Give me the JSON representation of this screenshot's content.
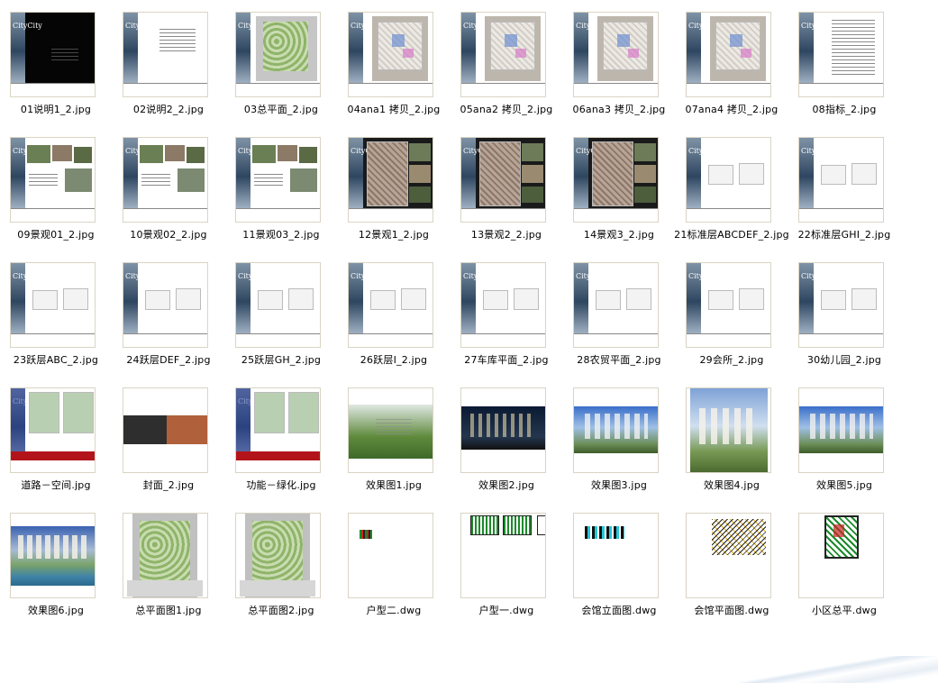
{
  "files": [
    {
      "name": "01说明1_2.jpg",
      "kind": "dark-sheet"
    },
    {
      "name": "02说明2_2.jpg",
      "kind": "text-sheet"
    },
    {
      "name": "03总平面_2.jpg",
      "kind": "site-plan-sheet"
    },
    {
      "name": "04ana1 拷贝_2.jpg",
      "kind": "analysis-sheet"
    },
    {
      "name": "05ana2 拷贝_2.jpg",
      "kind": "analysis-sheet"
    },
    {
      "name": "06ana3 拷贝_2.jpg",
      "kind": "analysis-sheet"
    },
    {
      "name": "07ana4 拷贝_2.jpg",
      "kind": "analysis-sheet"
    },
    {
      "name": "08指标_2.jpg",
      "kind": "table-sheet"
    },
    {
      "name": "09景观01_2.jpg",
      "kind": "photo-sheet"
    },
    {
      "name": "10景观02_2.jpg",
      "kind": "photo-sheet"
    },
    {
      "name": "11景观03_2.jpg",
      "kind": "photo-sheet"
    },
    {
      "name": "12景观1_2.jpg",
      "kind": "dark-plan-sheet"
    },
    {
      "name": "13景观2_2.jpg",
      "kind": "dark-plan-sheet"
    },
    {
      "name": "14景观3_2.jpg",
      "kind": "dark-plan-sheet"
    },
    {
      "name": "21标准层ABCDEF_2.jpg",
      "kind": "floorplan-sheet"
    },
    {
      "name": "22标准层GHI_2.jpg",
      "kind": "floorplan-sheet"
    },
    {
      "name": "23跃层ABC_2.jpg",
      "kind": "floorplan-sheet"
    },
    {
      "name": "24跃层DEF_2.jpg",
      "kind": "floorplan-sheet"
    },
    {
      "name": "25跃层GH_2.jpg",
      "kind": "floorplan-sheet"
    },
    {
      "name": "26跃层I_2.jpg",
      "kind": "floorplan-sheet"
    },
    {
      "name": "27车库平面_2.jpg",
      "kind": "floorplan-sheet"
    },
    {
      "name": "28农贸平面_2.jpg",
      "kind": "floorplan-sheet"
    },
    {
      "name": "29会所_2.jpg",
      "kind": "floorplan-sheet"
    },
    {
      "name": "30幼儿园_2.jpg",
      "kind": "floorplan-sheet"
    },
    {
      "name": "道路－空间.jpg",
      "kind": "road-sheet"
    },
    {
      "name": "封面_2.jpg",
      "kind": "cover"
    },
    {
      "name": "功能－绿化.jpg",
      "kind": "road-sheet"
    },
    {
      "name": "效果图1.jpg",
      "kind": "render-aerial"
    },
    {
      "name": "效果图2.jpg",
      "kind": "render-night"
    },
    {
      "name": "效果图3.jpg",
      "kind": "render-day"
    },
    {
      "name": "效果图4.jpg",
      "kind": "render-tall"
    },
    {
      "name": "效果图5.jpg",
      "kind": "render-day"
    },
    {
      "name": "效果图6.jpg",
      "kind": "render-lake"
    },
    {
      "name": "总平面图1.jpg",
      "kind": "site-plan"
    },
    {
      "name": "总平面图2.jpg",
      "kind": "site-plan"
    },
    {
      "name": "户型二.dwg",
      "kind": "dwg-small"
    },
    {
      "name": "户型一.dwg",
      "kind": "dwg-row"
    },
    {
      "name": "会馆立面图.dwg",
      "kind": "dwg-elev"
    },
    {
      "name": "会馆平面图.dwg",
      "kind": "dwg-plan"
    },
    {
      "name": "小区总平.dwg",
      "kind": "dwg-site"
    }
  ],
  "sheet_brand_text": "CityCity",
  "colors": {
    "thumb_border": "#d9d4c4",
    "label": "#000000",
    "band": "#2e4660"
  }
}
